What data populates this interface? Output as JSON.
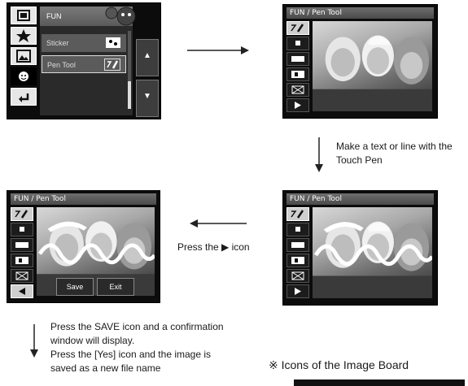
{
  "menu_screen": {
    "header": "FUN",
    "items": [
      {
        "label": "Sticker",
        "icon": "sticker-icon"
      },
      {
        "label": "Pen Tool",
        "icon": "pen-tool-icon"
      }
    ],
    "left_icons": [
      "frame-icon",
      "star-icon",
      "image-icon",
      "fun-face-icon",
      "back-icon"
    ],
    "nav_icons": [
      "up-arrow-icon",
      "down-arrow-icon"
    ]
  },
  "pen_screen_1": {
    "title": "FUN / Pen Tool"
  },
  "pen_screen_2": {
    "title": "FUN / Pen Tool"
  },
  "pen_screen_3": {
    "title": "FUN / Pen Tool",
    "buttons": {
      "save": "Save",
      "exit": "Exit"
    }
  },
  "tools": [
    "pen-icon",
    "thin-line-icon",
    "thick-line-icon",
    "color-icon",
    "eraser-icon",
    "next-icon"
  ],
  "captions": {
    "step1": "Make a text or line with the Touch Pen",
    "step2": "Press the ▶ icon",
    "step3_line1": "Press the SAVE icon and a confirmation",
    "step3_line2": "window will display.",
    "step3_line3": "Press the [Yes] icon and the image is",
    "step3_line4": "saved as a new file name",
    "note": "※ Icons of the Image Board"
  }
}
